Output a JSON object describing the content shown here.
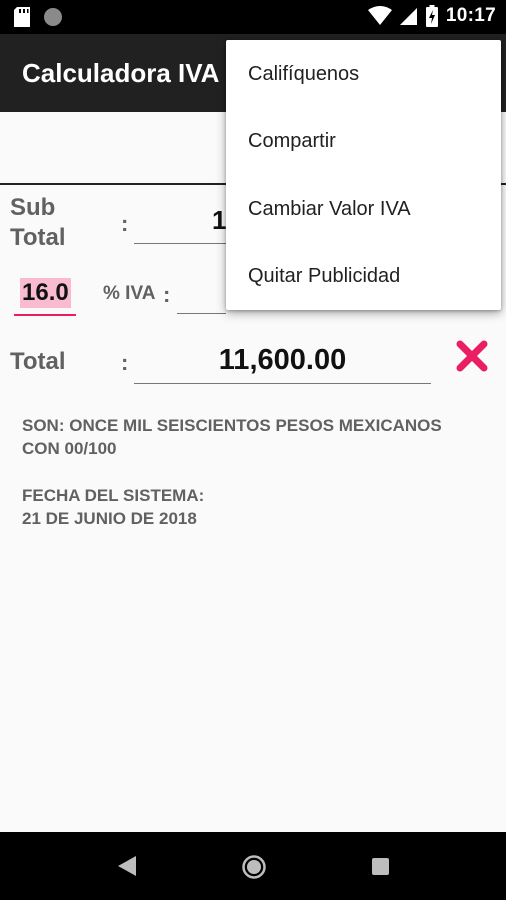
{
  "status_bar": {
    "time": "10:17",
    "icons": [
      "sd-card-icon",
      "circle-notification-icon",
      "wifi-icon",
      "cellular-signal-icon",
      "battery-charging-icon"
    ]
  },
  "app_bar": {
    "title": "Calculadora IVA"
  },
  "form": {
    "subtotal_label": "Sub\nTotal",
    "subtotal_colon": ":",
    "subtotal_value_visible": "1",
    "iva_rate_value": "16.0",
    "iva_label": "% IVA",
    "iva_colon": ":",
    "total_label": "Total",
    "total_colon": ":",
    "total_value": "11,600.00",
    "clear_icon": "close-icon"
  },
  "info": {
    "amount_words_line1": "SON: ONCE MIL SEISCIENTOS PESOS MEXICANOS",
    "amount_words_line2": "CON 00/100",
    "date_label": "FECHA DEL SISTEMA:",
    "date_value": "21 DE JUNIO DE 2018"
  },
  "menu": {
    "items": [
      "Califíquenos",
      "Compartir",
      "Cambiar Valor IVA",
      "Quitar Publicidad"
    ]
  },
  "colors": {
    "accent": "#e91e63",
    "app_bar": "#212121",
    "highlight": "#f8bbd0"
  }
}
